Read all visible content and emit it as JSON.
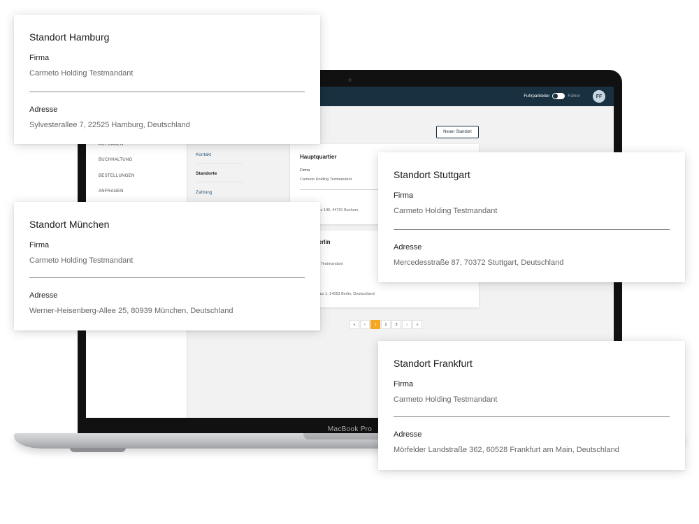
{
  "laptop": {
    "brand": "MacBook Pro"
  },
  "app": {
    "toggle": {
      "left_label": "Fuhrparkleiter",
      "right_label": "Fahrer"
    },
    "avatar_initials": "FF",
    "sidebar_items": [
      "AUFGABEN",
      "BUCHHALTUNG",
      "BESTELLUNGEN",
      "ANFRAGEN"
    ],
    "subnav_items": [
      "Kontakt",
      "Standorte",
      "Zahlung"
    ],
    "new_location_button": "Neuer Standort",
    "locations": [
      {
        "title": "Hauptquartier",
        "company_label": "Firma",
        "company": "Carmeto Holding Testmandant",
        "address_partial": "Straße 145, 44791 Bochum,"
      },
      {
        "title": "t Berlin",
        "company": "Testmandant",
        "address_partial": "er Platz 1, 14053 Berlin, Deutschland"
      }
    ],
    "pagination": [
      "«",
      "‹",
      "1",
      "2",
      "3",
      "›",
      "»"
    ],
    "pagination_active": "1"
  },
  "cards": {
    "hamburg": {
      "title": "Standort Hamburg",
      "company_label": "Firma",
      "company": "Carmeto Holding Testmandant",
      "address_label": "Adresse",
      "address": "Sylvesterallee 7, 22525 Hamburg, Deutschland"
    },
    "muenchen": {
      "title": "Standort München",
      "company_label": "Firma",
      "company": "Carmeto Holding Testmandant",
      "address_label": "Adresse",
      "address": "Werner-Heisenberg-Allee 25, 80939 München, Deutschland"
    },
    "stuttgart": {
      "title": "Standort Stuttgart",
      "company_label": "Firma",
      "company": "Carmeto Holding Testmandant",
      "address_label": "Adresse",
      "address": "Mercedesstraße 87, 70372 Stuttgart, Deutschland"
    },
    "frankfurt": {
      "title": "Standort Frankfurt",
      "company_label": "Firma",
      "company": "Carmeto Holding Testmandant",
      "address_label": "Adresse",
      "address": "Mörfelder Landstraße 362, 60528 Frankfurt am Main, Deutschland"
    }
  }
}
